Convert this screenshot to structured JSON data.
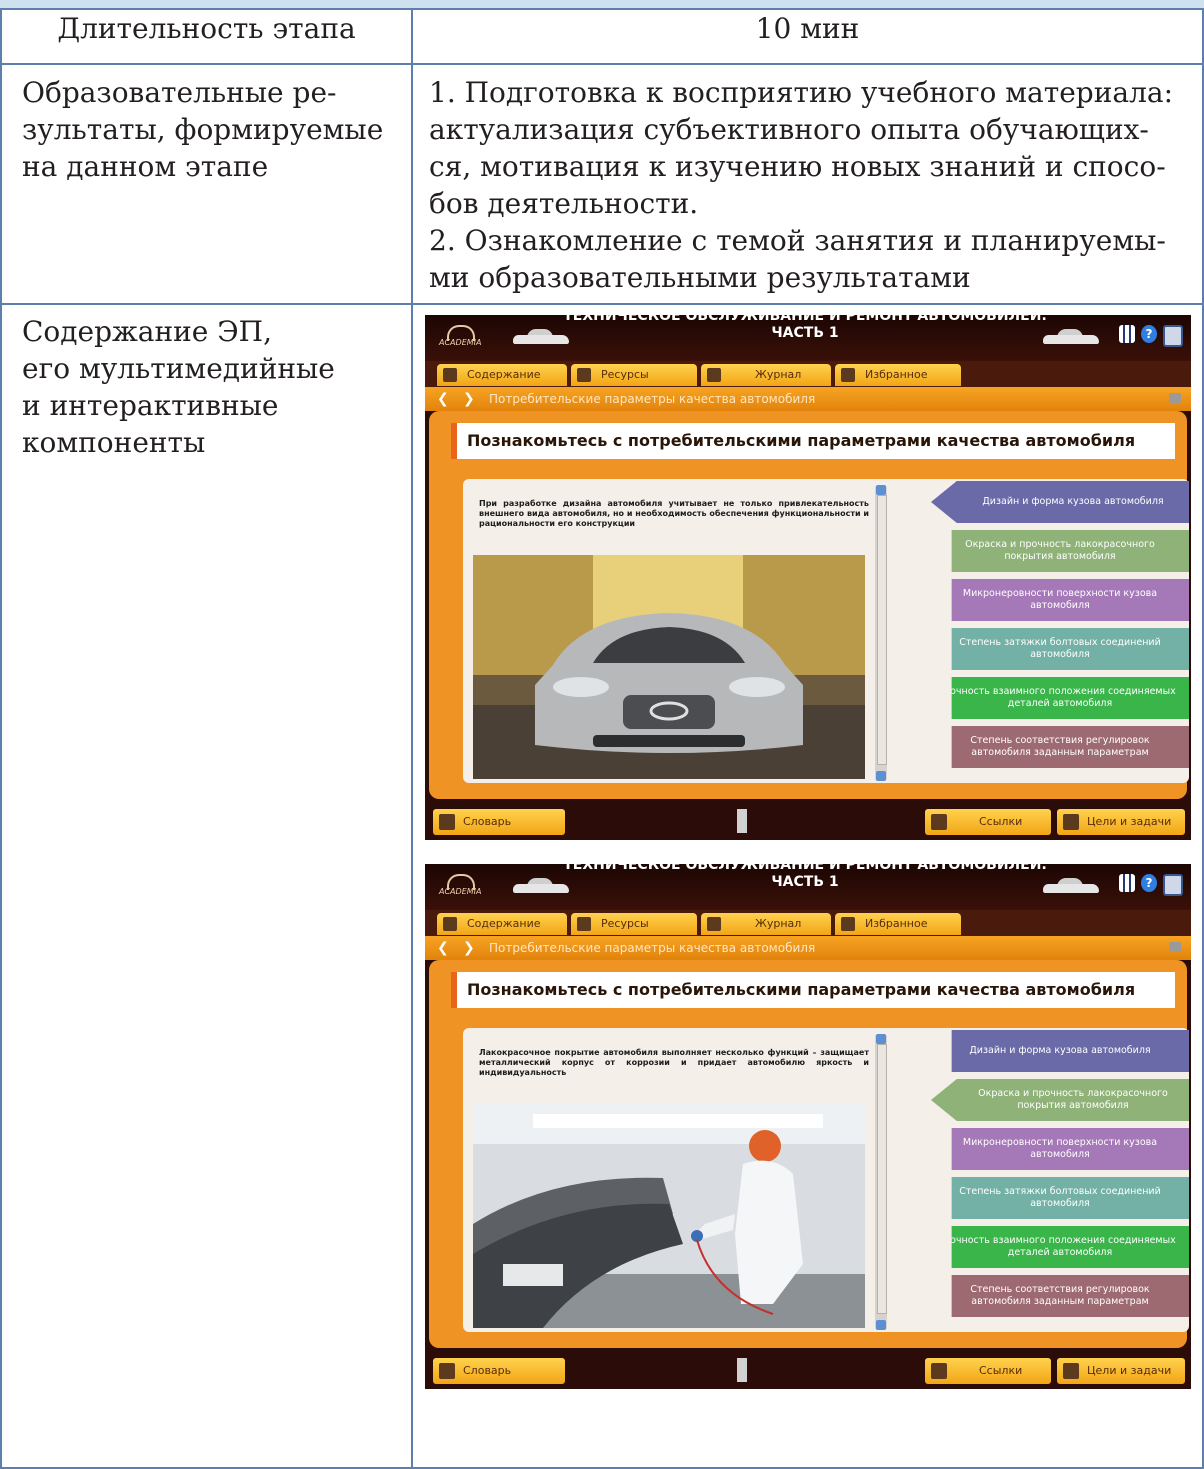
{
  "table": {
    "duration_label": "Длительность этапа",
    "duration_value": "10 мин",
    "results_label_lines": [
      "Образовательные ре-",
      "зультаты, формируемые",
      "на данном этапе"
    ],
    "results_value_lines": [
      "1. Подготовка к восприятию учебного материала:",
      "актуализация субъективного опыта обучающих-",
      "ся, мотивация к изучению новых знаний и спосо-",
      "бов деятельности.",
      "2. Ознакомление с темой занятия и планируемы-",
      "ми образовательными результатами"
    ],
    "content_label_lines": [
      "Содержание ЭП,",
      "его мультимедийные",
      "и интерактивные",
      "компоненты"
    ]
  },
  "app": {
    "logo": "ACADEMIA",
    "title_line1": "ТЕХНИЧЕСКОЕ ОБСЛУЖИВАНИЕ И РЕМОНТ АВТОМОБИЛЕЙ.",
    "title_line2": "ЧАСТЬ 1",
    "tabs": [
      "Содержание",
      "Ресурсы",
      "Журнал",
      "Избранное"
    ],
    "breadcrumb": "Потребительские параметры качества автомобиля",
    "heading": "Познакомьтесь с потребительскими параметрами качества автомобиля",
    "buttons": [
      {
        "label": "Дизайн и форма кузова автомобиля",
        "color": "#6a6aa8"
      },
      {
        "label": "Окраска и прочность лакокрасочного покрытия автомобиля",
        "color": "#8fb278"
      },
      {
        "label": "Микронеровности поверхности кузова автомобиля",
        "color": "#a578b8"
      },
      {
        "label": "Степень затяжки болтовых соединений автомобиля",
        "color": "#73b0a6"
      },
      {
        "label": "Точность взаимного положения соединяемых деталей автомобиля",
        "color": "#39b54a"
      },
      {
        "label": "Степень соответствия регулировок автомобиля заданным параметрам",
        "color": "#9e6a72"
      }
    ],
    "footer_left": "Словарь",
    "footer_links": "Ссылки",
    "footer_goals": "Цели и задачи",
    "screens": [
      {
        "text": "При разработке дизайна автомобиля учитывает не только привлекательность внешнего вида автомобиля, но и необходимость обеспечения функциональности и рациональности его конструкции",
        "active_index": 0
      },
      {
        "text": "Лакокрасочное покрытие автомобиля выполняет несколько функций – защищает металлический корпус от коррозии и придает автомобилю яркость и индивидуальность",
        "active_index": 1
      }
    ]
  }
}
